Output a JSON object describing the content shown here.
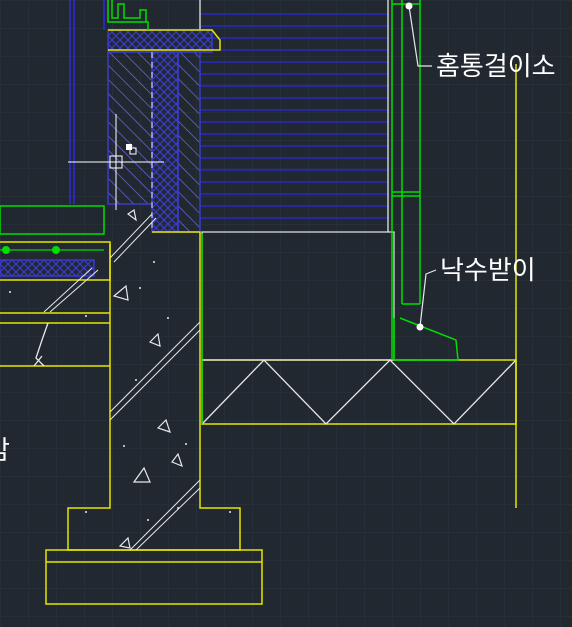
{
  "colors": {
    "background": "#212830",
    "grid": "#2c3540",
    "structure_yellow": "#e6e600",
    "flashing_green": "#00dd00",
    "insulation_blue": "#1f1fc8",
    "hatch_blue": "#3a3acb",
    "white_line": "#e8e8e8"
  },
  "labels": {
    "gutter_hanger": "홈통걸이소",
    "drip_tray": "낙수받이",
    "cut_left": "암"
  },
  "icons": {
    "crosshair": "cad-crosshair-cursor",
    "pickbox": "cad-pickbox",
    "anchor_nodes": "leader-anchor-dot"
  }
}
